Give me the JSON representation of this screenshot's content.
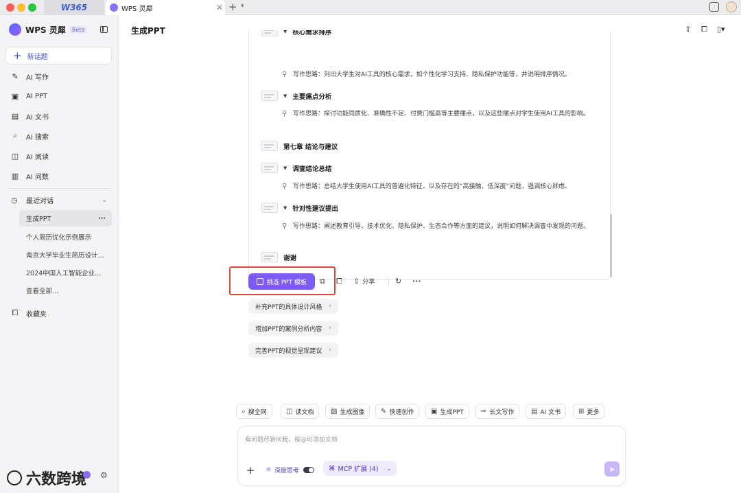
{
  "titlebar": {
    "tabs": [
      {
        "label": "W365"
      },
      {
        "label": "WPS 灵犀"
      }
    ]
  },
  "sidebar": {
    "brand": "WPS 灵犀",
    "beta": "Beta",
    "new_topic": "新话题",
    "nav": [
      {
        "label": "AI 写作",
        "icon": "pen-icon"
      },
      {
        "label": "AI PPT",
        "icon": "ppt-icon"
      },
      {
        "label": "AI 文书",
        "icon": "document-icon"
      },
      {
        "label": "AI 搜索",
        "icon": "search-icon"
      },
      {
        "label": "AI 阅读",
        "icon": "book-icon"
      },
      {
        "label": "AI 问数",
        "icon": "chart-icon"
      }
    ],
    "recent_title": "最近对话",
    "recent_selected": "生成PPT",
    "recent_items": [
      "个人简历优化示例展示",
      "南京大学毕业生简历设计...",
      "2024中国人工智能企业...",
      "查看全部..."
    ],
    "favorites": "收藏夹",
    "footer_logo": "六数跨境"
  },
  "main": {
    "title": "生成PPT",
    "outline": [
      {
        "kind": "sub",
        "title": "核心需求排序"
      },
      {
        "kind": "idea",
        "text": "写作思路：列出大学生对AI工具的核心需求，如个性化学习支持、隐私保护功能等，并说明排序情况。"
      },
      {
        "kind": "sub",
        "title": "主要痛点分析"
      },
      {
        "kind": "idea",
        "text": "写作思路：探讨功能同质化、准确性不足、付费门槛高等主要痛点，以及这些痛点对学生使用AI工具的影响。"
      },
      {
        "kind": "chapter",
        "title": "第七章 结论与建议"
      },
      {
        "kind": "sub",
        "title": "调查结论总结"
      },
      {
        "kind": "idea",
        "text": "写作思路：总结大学生使用AI工具的普遍化特征，以及存在的“高接触、低深度”问题，强调核心顾虑。"
      },
      {
        "kind": "sub",
        "title": "针对性建议提出"
      },
      {
        "kind": "idea",
        "text": "写作思路：阐述教育引导、技术优化、隐私保护、生态合作等方面的建议，说明如何解决调查中发现的问题。"
      },
      {
        "kind": "chapter",
        "title": "谢谢"
      }
    ],
    "pick_template": "挑选 PPT 模板",
    "share": "分享",
    "suggestions": [
      "补充PPT的具体设计风格",
      "增加PPT的案例分析内容",
      "完善PPT的视觉呈现建议"
    ],
    "tools": [
      {
        "label": "搜全网",
        "icon": "search-icon"
      },
      {
        "label": "读文档",
        "icon": "book-icon"
      },
      {
        "label": "生成图像",
        "icon": "image-icon"
      },
      {
        "label": "快速创作",
        "icon": "pen-icon"
      },
      {
        "label": "生成PPT",
        "icon": "ppt-icon"
      },
      {
        "label": "长文写作",
        "icon": "longtext-icon"
      },
      {
        "label": "AI 文书",
        "icon": "document-icon"
      },
      {
        "label": "更多",
        "icon": "grid-icon"
      }
    ],
    "input_placeholder": "有问题尽管问我，按@可添加文档",
    "deep_think": "深度思考",
    "mcp": "MCP 扩展 (4)"
  },
  "colors": {
    "accent": "#7d5cf6",
    "highlight": "#e0443a"
  }
}
